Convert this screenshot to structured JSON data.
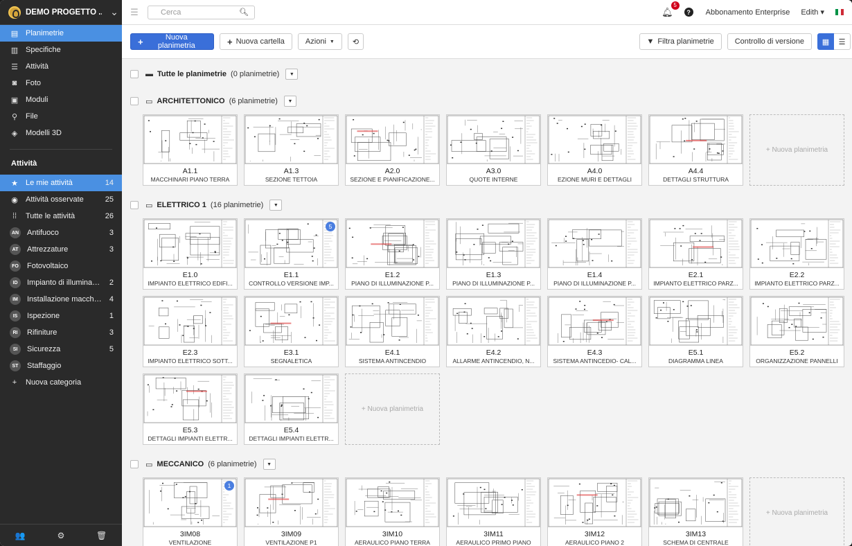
{
  "project": {
    "name": "DEMO PROGETTO ..."
  },
  "nav": [
    {
      "label": "Planimetrie",
      "icon": "floorplan-icon",
      "glyph": "▤",
      "active": true
    },
    {
      "label": "Specifiche",
      "icon": "spec-icon",
      "glyph": "▥",
      "active": false
    },
    {
      "label": "Attività",
      "icon": "list-icon",
      "glyph": "☰",
      "active": false
    },
    {
      "label": "Foto",
      "icon": "camera-icon",
      "glyph": "◙",
      "active": false
    },
    {
      "label": "Moduli",
      "icon": "clipboard-icon",
      "glyph": "▣",
      "active": false
    },
    {
      "label": "File",
      "icon": "paperclip-icon",
      "glyph": "⚲",
      "active": false
    },
    {
      "label": "Modelli 3D",
      "icon": "cube-icon",
      "glyph": "◈",
      "active": false
    }
  ],
  "tasks_section": "Attività",
  "task_items": [
    {
      "label": "Le mie attività",
      "count": "14",
      "glyph": "★",
      "abbr": "",
      "active": true
    },
    {
      "label": "Attività osservate",
      "count": "25",
      "glyph": "◉",
      "abbr": "",
      "active": false
    },
    {
      "label": "Tutte le attività",
      "count": "26",
      "glyph": "⁞⁞",
      "abbr": "",
      "active": false
    },
    {
      "label": "Antifuoco",
      "count": "3",
      "glyph": "",
      "abbr": "AN",
      "active": false
    },
    {
      "label": "Attrezzature",
      "count": "3",
      "glyph": "",
      "abbr": "AT",
      "active": false
    },
    {
      "label": "Fotovoltaico",
      "count": "",
      "glyph": "",
      "abbr": "FO",
      "active": false
    },
    {
      "label": "Impianto di illuminazi...",
      "count": "2",
      "glyph": "",
      "abbr": "ID",
      "active": false
    },
    {
      "label": "Installazione macchin...",
      "count": "4",
      "glyph": "",
      "abbr": "IM",
      "active": false
    },
    {
      "label": "Ispezione",
      "count": "1",
      "glyph": "",
      "abbr": "IS",
      "active": false
    },
    {
      "label": "Rifiniture",
      "count": "3",
      "glyph": "",
      "abbr": "RI",
      "active": false
    },
    {
      "label": "Sicurezza",
      "count": "5",
      "glyph": "",
      "abbr": "SI",
      "active": false
    },
    {
      "label": "Staffaggio",
      "count": "",
      "glyph": "",
      "abbr": "ST",
      "active": false
    },
    {
      "label": "Nuova categoria",
      "count": "",
      "glyph": "+",
      "abbr": "",
      "active": false
    }
  ],
  "topbar": {
    "search_placeholder": "Cerca",
    "notifications": "5",
    "subscription": "Abbonamento Enterprise",
    "user": "Edith ▾"
  },
  "toolbar": {
    "new_plan": "Nuova planimetria",
    "new_folder": "Nuova cartella",
    "actions": "Azioni",
    "filter": "Filtra planimetrie",
    "version_control": "Controllo di versione"
  },
  "new_plan_card": "+ Nuova planimetria",
  "folders": [
    {
      "name": "Tutte le planimetrie",
      "count": "(0 planimetrie)",
      "icon": "folder-icon",
      "plans": [],
      "add": false
    },
    {
      "name": "ARCHITETTONICO",
      "count": "(6 planimetrie)",
      "icon": "folder-open-icon",
      "add": true,
      "plans": [
        {
          "code": "A1.1",
          "title": "MACCHINARI PIANO TERRA",
          "badge": ""
        },
        {
          "code": "A1.3",
          "title": "SEZIONE TETTOIA",
          "badge": ""
        },
        {
          "code": "A2.0",
          "title": "SEZIONE E PIANIFICAZIONE...",
          "badge": ""
        },
        {
          "code": "A3.0",
          "title": "QUOTE INTERNE",
          "badge": ""
        },
        {
          "code": "A4.0",
          "title": "EZIONE MURI E DETTAGLI",
          "badge": ""
        },
        {
          "code": "A4.4",
          "title": "DETTAGLI STRUTTURA",
          "badge": ""
        }
      ]
    },
    {
      "name": "ELETTRICO 1",
      "count": "(16 planimetrie)",
      "icon": "folder-open-icon",
      "add": true,
      "plans": [
        {
          "code": "E1.0",
          "title": "IMPIANTO ELETTRICO EDIFI...",
          "badge": ""
        },
        {
          "code": "E1.1",
          "title": "CONTROLLO VERSIONE IMP...",
          "badge": "5"
        },
        {
          "code": "E1.2",
          "title": "PIANO DI ILLUMINAZIONE P...",
          "badge": ""
        },
        {
          "code": "E1.3",
          "title": "PIANO DI ILLUMINAZIONE P...",
          "badge": ""
        },
        {
          "code": "E1.4",
          "title": "PIANO DI ILLUMINAZIONE P...",
          "badge": ""
        },
        {
          "code": "E2.1",
          "title": "IMPIANTO ELETTRICO PARZ...",
          "badge": ""
        },
        {
          "code": "E2.2",
          "title": "IMPIANTO ELETTRICO PARZ...",
          "badge": ""
        },
        {
          "code": "E2.3",
          "title": "IMPIANTO ELETTRICO SOTT...",
          "badge": ""
        },
        {
          "code": "E3.1",
          "title": "SEGNALETICA",
          "badge": ""
        },
        {
          "code": "E4.1",
          "title": "SISTEMA ANTINCENDIO",
          "badge": ""
        },
        {
          "code": "E4.2",
          "title": "ALLARME ANTINCENDIO, N...",
          "badge": ""
        },
        {
          "code": "E4.3",
          "title": "SISTEMA ANTINCEDIO- CAL...",
          "badge": ""
        },
        {
          "code": "E5.1",
          "title": "DIAGRAMMA LINEA",
          "badge": ""
        },
        {
          "code": "E5.2",
          "title": "ORGANIZZAZIONE PANNELLI",
          "badge": ""
        },
        {
          "code": "E5.3",
          "title": "DETTAGLI IMPIANTI ELETTR...",
          "badge": ""
        },
        {
          "code": "E5.4",
          "title": "DETTAGLI IMPIANTI ELETTR...",
          "badge": ""
        }
      ]
    },
    {
      "name": "MECCANICO",
      "count": "(6 planimetrie)",
      "icon": "folder-open-icon",
      "add": true,
      "plans": [
        {
          "code": "3IM08",
          "title": "VENTILAZIONE",
          "badge": "1"
        },
        {
          "code": "3IM09",
          "title": "VENTILAZIONE P1",
          "badge": ""
        },
        {
          "code": "3IM10",
          "title": "AERAULICO PIANO TERRA",
          "badge": ""
        },
        {
          "code": "3IM11",
          "title": "AERAULICO PRIMO PIANO",
          "badge": ""
        },
        {
          "code": "3IM12",
          "title": "AERAULICO PIANO 2",
          "badge": ""
        },
        {
          "code": "3IM13",
          "title": "SCHEMA DI CENTRALE",
          "badge": ""
        }
      ]
    }
  ],
  "colors": {
    "accent": "#3a6fd9",
    "active_nav": "#4a90e2",
    "sidebar_bg": "#2a2a2a",
    "badge_red": "#d0021b"
  }
}
